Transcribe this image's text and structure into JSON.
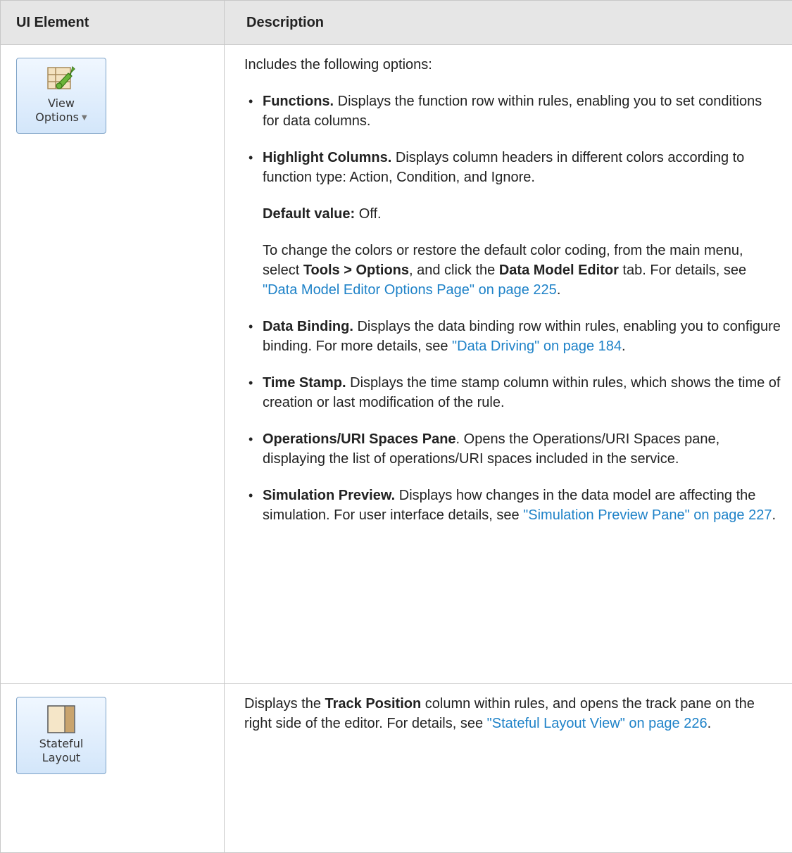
{
  "header": {
    "col1": "UI Element",
    "col2": "Description"
  },
  "row1": {
    "button_line1": "View",
    "button_line2": "Options",
    "intro": "Includes the following options:",
    "functions": {
      "b": "Functions.",
      "t": " Displays the function row within rules, enabling you to set conditions for data columns."
    },
    "highlight": {
      "b": "Highlight Columns.",
      "t": " Displays column headers in different colors according to function type: Action, Condition, and Ignore.",
      "default_b": "Default value:",
      "default_t": " Off.",
      "p2_a": "To change the colors or restore the default color coding, from the main menu, select ",
      "p2_b1": "Tools > Options",
      "p2_c": ", and click the ",
      "p2_b2": "Data Model Editor",
      "p2_d": " tab. For details, see ",
      "p2_link": "\"Data Model Editor Options Page\" on page 225",
      "p2_e": "."
    },
    "binding": {
      "b": "Data Binding.",
      "t": " Displays the data binding row within rules, enabling you to configure binding. For more details, see ",
      "link": "\"Data Driving\" on page 184",
      "end": "."
    },
    "timestamp": {
      "b": "Time Stamp.",
      "t": " Displays the time stamp column within rules, which shows the time of creation or last modification of the rule."
    },
    "operations": {
      "b": "Operations/URI Spaces Pane",
      "t": ". Opens the Operations/URI Spaces pane, displaying the list of operations/URI spaces included in the service."
    },
    "preview": {
      "b": "Simulation Preview.",
      "t": " Displays how changes in the data model are affecting the simulation. For user interface details, see ",
      "link": "\"Simulation Preview Pane\" on page 227",
      "end": "."
    }
  },
  "row2": {
    "button_line1": "Stateful",
    "button_line2": "Layout",
    "a": "Displays the ",
    "b": "Track Position",
    "c": " column within rules, and opens the track pane on the right side of the editor. For details, see ",
    "link": "\"Stateful Layout View\" on page 226",
    "end": "."
  }
}
